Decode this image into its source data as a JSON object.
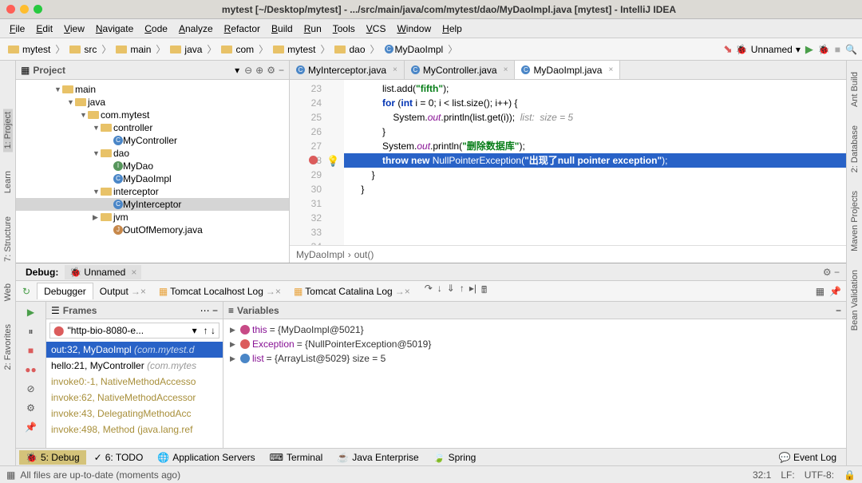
{
  "titlebar": {
    "title": "mytest [~/Desktop/mytest] - .../src/main/java/com/mytest/dao/MyDaoImpl.java [mytest] - IntelliJ IDEA"
  },
  "menubar": {
    "items": [
      "File",
      "Edit",
      "View",
      "Navigate",
      "Code",
      "Analyze",
      "Refactor",
      "Build",
      "Run",
      "Tools",
      "VCS",
      "Window",
      "Help"
    ]
  },
  "breadcrumb": {
    "items": [
      "mytest",
      "src",
      "main",
      "java",
      "com",
      "mytest",
      "dao",
      "MyDaoImpl"
    ]
  },
  "run_config": {
    "name": "Unnamed"
  },
  "left_gutter": {
    "items": [
      "1: Project",
      "Learn",
      "7: Structure",
      "Web",
      "2: Favorites"
    ]
  },
  "right_gutter": {
    "items": [
      "Ant Build",
      "2: Database",
      "Maven Projects",
      "Bean Validation"
    ]
  },
  "project_panel": {
    "title": "Project",
    "tree": [
      {
        "indent": 3,
        "arrow": "▼",
        "icon": "folder",
        "label": "main"
      },
      {
        "indent": 4,
        "arrow": "▼",
        "icon": "folder",
        "label": "java"
      },
      {
        "indent": 5,
        "arrow": "▼",
        "icon": "folder",
        "label": "com.mytest"
      },
      {
        "indent": 6,
        "arrow": "▼",
        "icon": "folder",
        "label": "controller"
      },
      {
        "indent": 7,
        "arrow": "",
        "icon": "class",
        "label": "MyController"
      },
      {
        "indent": 6,
        "arrow": "▼",
        "icon": "folder",
        "label": "dao"
      },
      {
        "indent": 7,
        "arrow": "",
        "icon": "interface",
        "label": "MyDao"
      },
      {
        "indent": 7,
        "arrow": "",
        "icon": "class",
        "label": "MyDaoImpl"
      },
      {
        "indent": 6,
        "arrow": "▼",
        "icon": "folder",
        "label": "interceptor"
      },
      {
        "indent": 7,
        "arrow": "",
        "icon": "class",
        "label": "MyInterceptor",
        "selected": true
      },
      {
        "indent": 6,
        "arrow": "▶",
        "icon": "folder",
        "label": "jvm"
      },
      {
        "indent": 7,
        "arrow": "",
        "icon": "java",
        "label": "OutOfMemory.java"
      }
    ]
  },
  "editor": {
    "tabs": [
      {
        "label": "MyInterceptor.java",
        "active": false
      },
      {
        "label": "MyController.java",
        "active": false
      },
      {
        "label": "MyDaoImpl.java",
        "active": true
      }
    ],
    "lines_start": 23,
    "breadcrumb": [
      "MyDaoImpl",
      "out()"
    ],
    "code": {
      "l23": "            list.add(\"fifth\");",
      "l24": "",
      "l25_pre": "            ",
      "l25_for": "for",
      "l25_mid1": " (",
      "l25_int": "int",
      "l25_rest": " i = 0; i < list.size(); i++) {",
      "l26_pre": "                System.",
      "l26_out": "out",
      "l26_post": ".println(list.get(i));  ",
      "l26_com": "list:  size = 5",
      "l27": "            }",
      "l28": "",
      "l29": "",
      "l30_pre": "            System.",
      "l30_out": "out",
      "l30_mid": ".println(",
      "l30_str": "\"删除数据库\"",
      "l30_end": ");",
      "l31": "",
      "l32_pre": "            ",
      "l32_throw": "throw new",
      "l32_mid": " NullPointerException(",
      "l32_str": "\"出现了null pointer exception\"",
      "l32_end": ");",
      "l33": "        }",
      "l34": "    }"
    }
  },
  "debug": {
    "title": "Debug:",
    "config": "Unnamed",
    "tabs": [
      "Debugger",
      "Output",
      "Tomcat Localhost Log",
      "Tomcat Catalina Log"
    ],
    "frames_title": "Frames",
    "vars_title": "Variables",
    "thread": "\"http-bio-8080-e...",
    "frames": [
      {
        "text": "out:32, MyDaoImpl",
        "pkg": "(com.mytest.d",
        "selected": true
      },
      {
        "text": "hello:21, MyController",
        "pkg": "(com.mytes",
        "selected": false
      },
      {
        "text": "invoke0:-1, NativeMethodAccesso",
        "lib": true
      },
      {
        "text": "invoke:62, NativeMethodAccessor",
        "lib": true
      },
      {
        "text": "invoke:43, DelegatingMethodAcc",
        "lib": true
      },
      {
        "text": "invoke:498, Method (java.lang.ref",
        "lib": true
      }
    ],
    "variables": [
      {
        "name": "this",
        "val": "= {MyDaoImpl@5021}",
        "icon": "p"
      },
      {
        "name": "Exception",
        "val": "= {NullPointerException@5019}",
        "icon": "e"
      },
      {
        "name": "list",
        "val": "= {ArrayList@5029}  size = 5",
        "icon": "o"
      }
    ]
  },
  "bottom_tabs": {
    "items": [
      "5: Debug",
      "6: TODO",
      "Application Servers",
      "Terminal",
      "Java Enterprise",
      "Spring"
    ],
    "event_log": "Event Log"
  },
  "statusbar": {
    "message": "All files are up-to-date (moments ago)",
    "pos": "32:1",
    "lf": "LF:",
    "enc": "UTF-8:"
  }
}
